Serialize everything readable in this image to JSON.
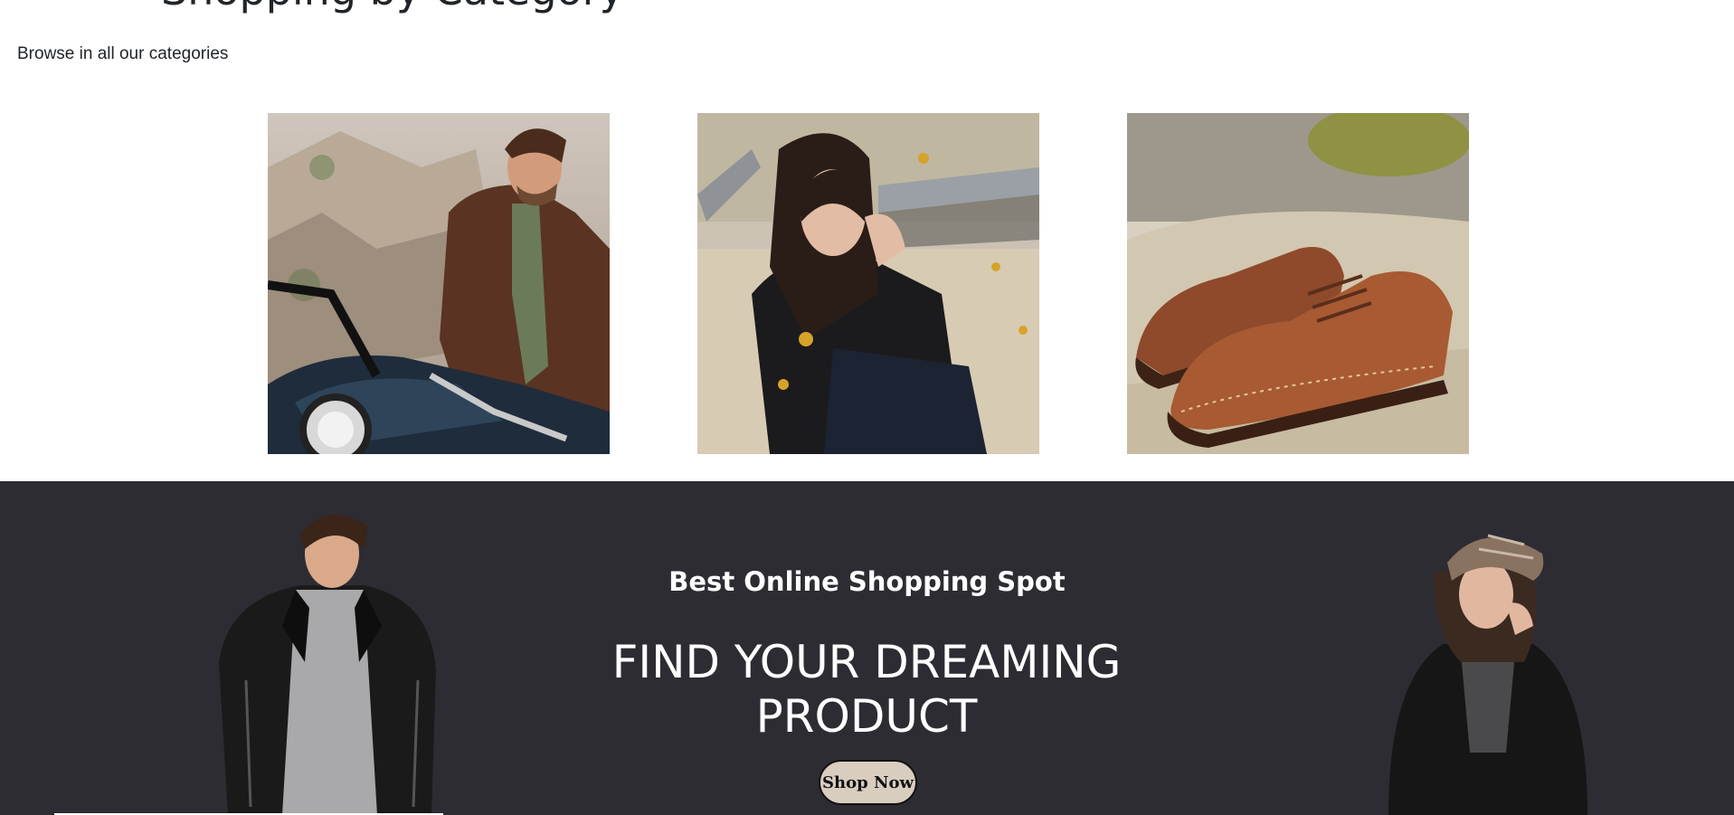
{
  "page": {
    "heading_partial": "Shopping by Category",
    "subtitle": "Browse in all our categories"
  },
  "categories": [
    {
      "name": "men-jacket",
      "icon": "man-on-motorcycle-photo"
    },
    {
      "name": "women-jacket",
      "icon": "woman-leather-jacket-photo"
    },
    {
      "name": "shoes",
      "icon": "brown-brogue-shoes-photo"
    }
  ],
  "banner": {
    "tagline": "Best Online Shopping Spot",
    "headline": "FIND YOUR DREAMING PRODUCT",
    "cta_label": "Shop Now",
    "background_color": "#2e2c33",
    "cta_color": "#d8cdbf"
  }
}
